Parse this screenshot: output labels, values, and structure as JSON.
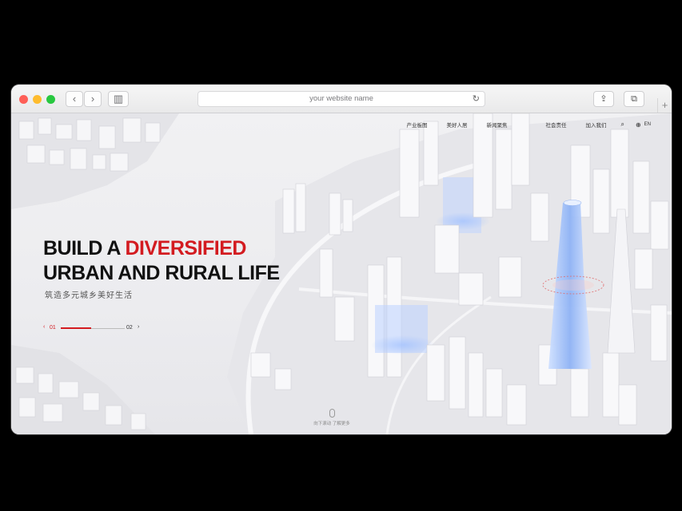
{
  "browser": {
    "url_text": "your website name",
    "reload_icon": "↻",
    "back_icon": "‹",
    "forward_icon": "›",
    "sidebar_icon": "▥",
    "share_icon": "⇪",
    "tabs_icon": "⧉",
    "new_tab_icon": "+"
  },
  "nav": {
    "items": [
      "产业板图",
      "美好人居",
      "新闻聚焦",
      "社会责任",
      "加入我们"
    ],
    "search_icon": "⌕",
    "globe_icon": "⊕",
    "lang_label": "EN"
  },
  "hero": {
    "title_part1": "BUILD A ",
    "title_highlight": "DIVERSIFIED",
    "title_line2": "URBAN AND RURAL LIFE",
    "subtitle": "筑造多元城乡美好生活",
    "accent_color": "#d31b20"
  },
  "pager": {
    "prev_arrow": "‹",
    "current": "01",
    "next": "02",
    "next_arrow": "›"
  },
  "scroll_hint": {
    "text": "向下滚动 了解更多"
  }
}
